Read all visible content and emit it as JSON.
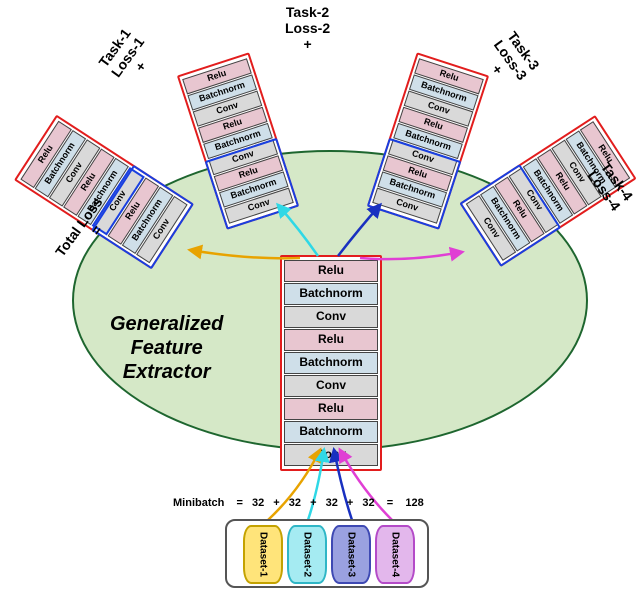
{
  "layers": [
    "Relu",
    "Batchnorm",
    "Conv",
    "Relu",
    "Batchnorm",
    "Conv",
    "Relu",
    "Batchnorm",
    "Conv"
  ],
  "tasks": [
    {
      "label": "Task-1",
      "loss": "Loss-1"
    },
    {
      "label": "Task-2",
      "loss": "Loss-2"
    },
    {
      "label": "Task-3",
      "loss": "Loss-3"
    },
    {
      "label": "Task-4",
      "loss": "Loss-4"
    }
  ],
  "center_label": "Generalized\nFeature\nExtractor",
  "total_loss_label": "Total Loss",
  "equals": "=",
  "plus": "+",
  "datasets": [
    "Dataset-1",
    "Dataset-2",
    "Dataset-3",
    "Dataset-4"
  ],
  "minibatch_label": "Minibatch",
  "minibatch_values": [
    32,
    32,
    32,
    32
  ],
  "minibatch_total": 128,
  "colors": {
    "task1": "#e8a300",
    "task2": "#2fd8e6",
    "task3": "#1930c0",
    "task4": "#e03fd4",
    "shared_border": "#e21d1d",
    "private_border": "#193fe0"
  }
}
